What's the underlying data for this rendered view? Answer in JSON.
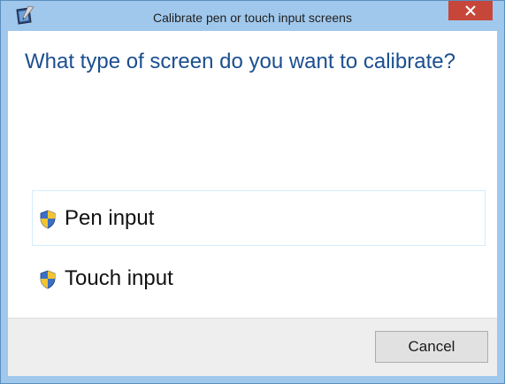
{
  "window": {
    "title": "Calibrate pen or touch input screens",
    "icon": "tablet-calibration-icon",
    "close_icon": "close-icon",
    "accent": "#a0c8ec",
    "close_color": "#c7463a"
  },
  "main": {
    "question": "What type of screen do you want to calibrate?",
    "options": [
      {
        "label": "Pen input",
        "icon": "uac-shield-icon"
      },
      {
        "label": "Touch input",
        "icon": "uac-shield-icon"
      }
    ]
  },
  "footer": {
    "cancel_label": "Cancel"
  }
}
